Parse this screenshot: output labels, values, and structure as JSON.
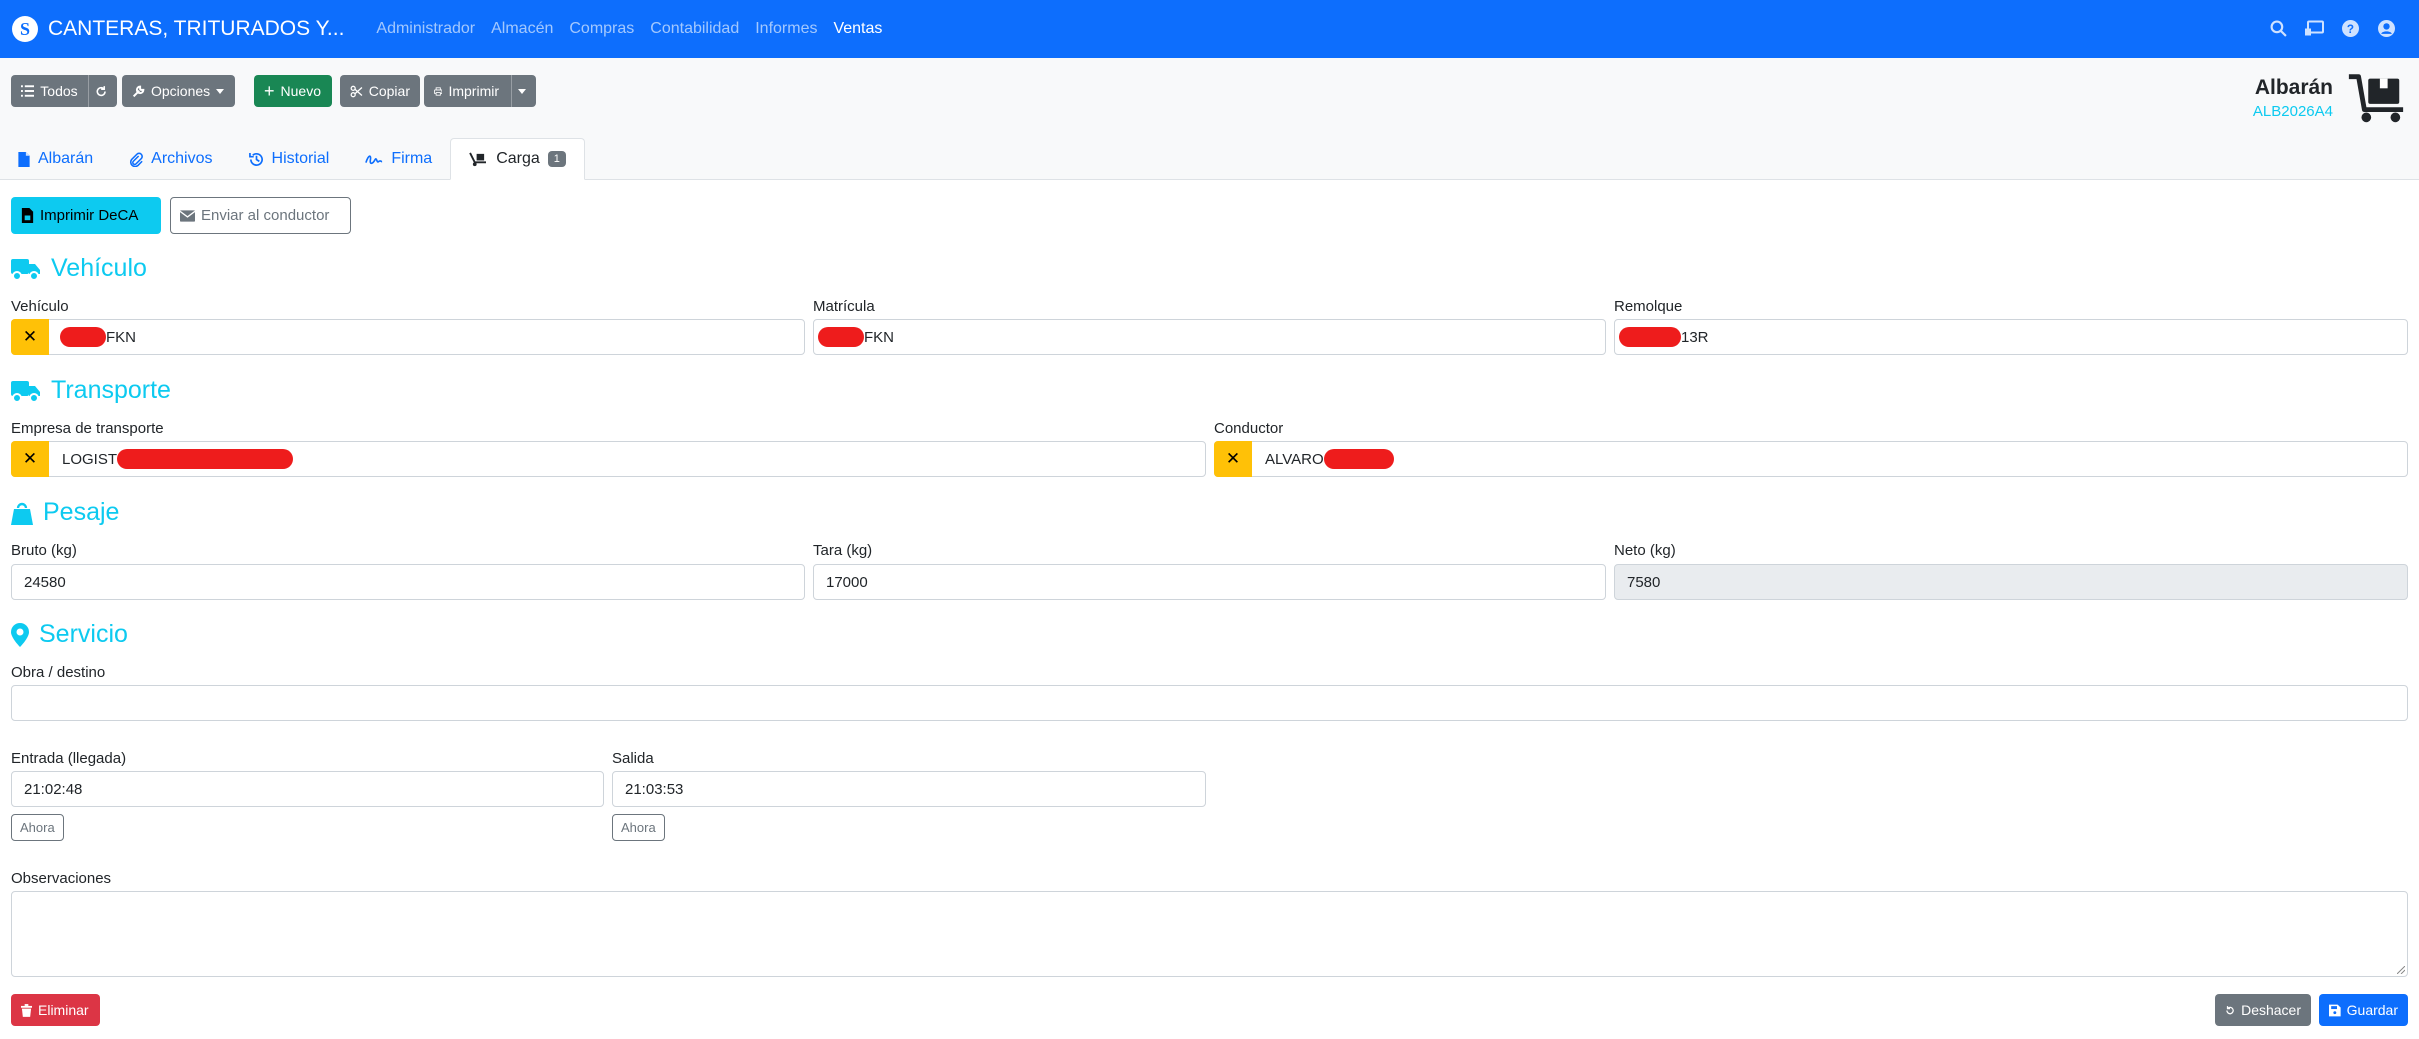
{
  "app": {
    "company": "CANTERAS, TRITURADOS Y...",
    "logo_letter": "S"
  },
  "menu": [
    "Administrador",
    "Almacén",
    "Compras",
    "Contabilidad",
    "Informes",
    "Ventas"
  ],
  "menu_active": "Ventas",
  "toolbar": {
    "todos": "Todos",
    "opciones": "Opciones",
    "nuevo": "Nuevo",
    "copiar": "Copiar",
    "imprimir": "Imprimir"
  },
  "doc": {
    "title": "Albarán",
    "code": "ALB2026A4"
  },
  "tabs": [
    {
      "label": "Albarán",
      "icon": "file-icon"
    },
    {
      "label": "Archivos",
      "icon": "paperclip-icon"
    },
    {
      "label": "Historial",
      "icon": "history-icon"
    },
    {
      "label": "Firma",
      "icon": "signature-icon"
    },
    {
      "label": "Carga",
      "icon": "truck-loading-icon",
      "badge": "1"
    }
  ],
  "actions": {
    "print_deca": "Imprimir DeCA",
    "send_driver": "Enviar al conductor"
  },
  "sections": {
    "vehiculo": {
      "title": "Vehículo"
    },
    "transporte": {
      "title": "Transporte"
    },
    "pesaje": {
      "title": "Pesaje"
    },
    "servicio": {
      "title": "Servicio"
    }
  },
  "fields": {
    "vehiculo": {
      "label": "Vehículo",
      "suffix": "FKN"
    },
    "matricula": {
      "label": "Matrícula",
      "suffix": "FKN"
    },
    "remolque": {
      "label": "Remolque",
      "suffix": "13R"
    },
    "empresa": {
      "label": "Empresa de transporte",
      "prefix": "LOGIST"
    },
    "conductor": {
      "label": "Conductor",
      "prefix": "ALVARO"
    },
    "bruto": {
      "label": "Bruto (kg)",
      "value": "24580"
    },
    "tara": {
      "label": "Tara (kg)",
      "value": "17000"
    },
    "neto": {
      "label": "Neto (kg)",
      "value": "7580"
    },
    "obra": {
      "label": "Obra / destino",
      "value": ""
    },
    "entrada": {
      "label": "Entrada (llegada)",
      "value": "21:02:48"
    },
    "salida": {
      "label": "Salida",
      "value": "21:03:53"
    },
    "observaciones": {
      "label": "Observaciones",
      "value": ""
    }
  },
  "ahora": "Ahora",
  "footer": {
    "eliminar": "Eliminar",
    "deshacer": "Deshacer",
    "guardar": "Guardar"
  },
  "colors": {
    "primary": "#0d6efd",
    "info": "#0dcaf0",
    "warning": "#ffc107",
    "danger": "#dc3545",
    "success": "#198754",
    "secondary": "#6c757d"
  }
}
